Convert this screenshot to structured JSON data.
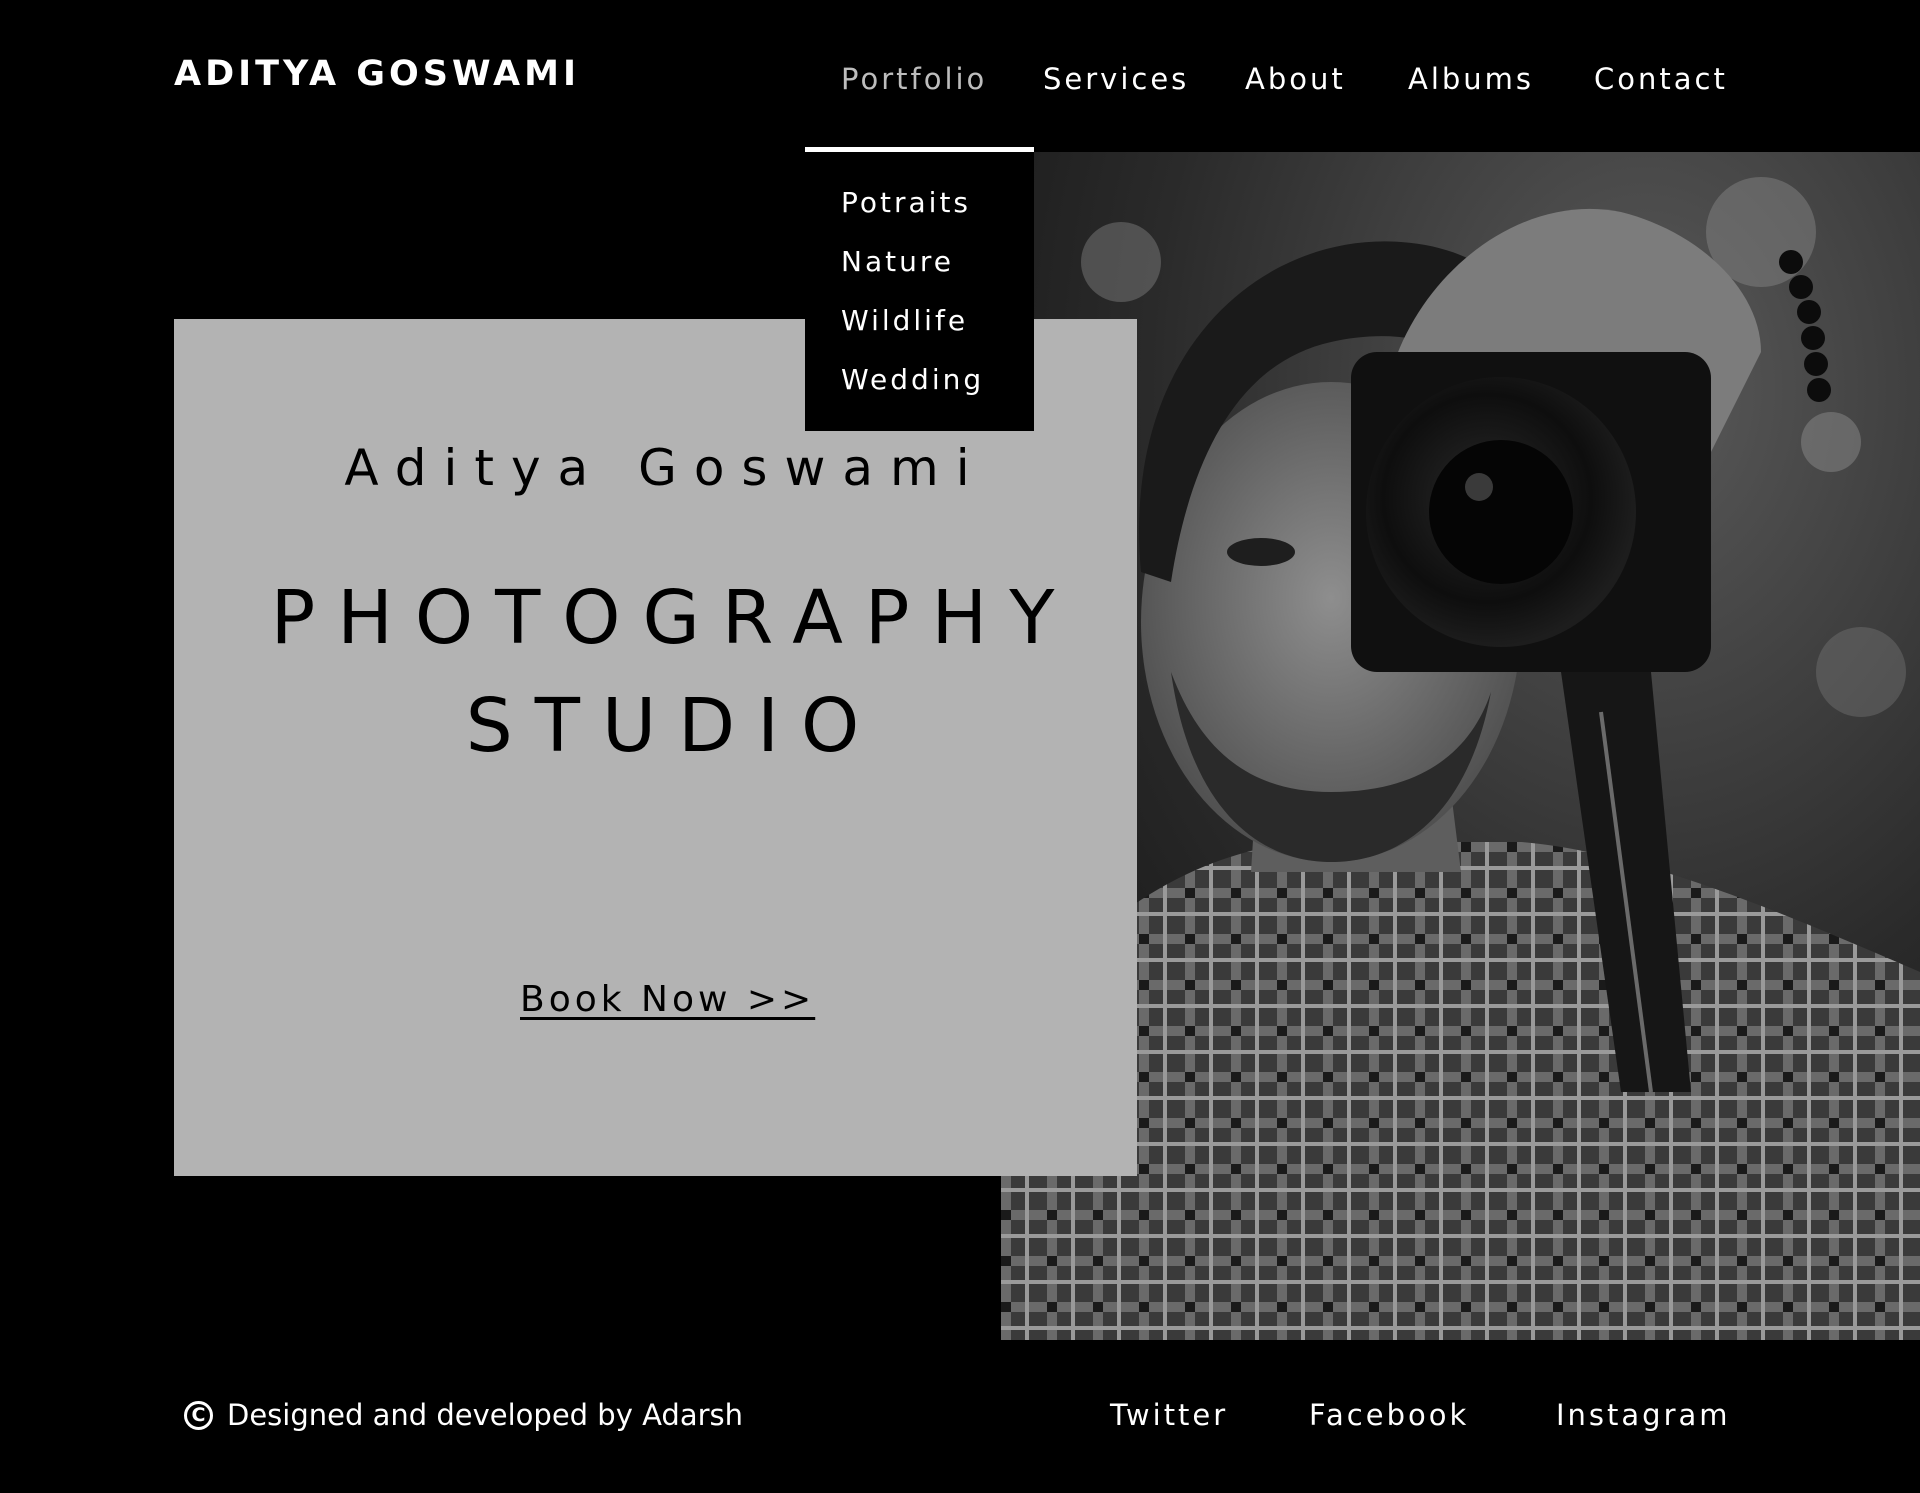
{
  "header": {
    "brand": "ADITYA GOSWAMI",
    "nav": [
      {
        "label": "Portfolio",
        "active": true
      },
      {
        "label": "Services"
      },
      {
        "label": "About"
      },
      {
        "label": "Albums"
      },
      {
        "label": "Contact"
      }
    ]
  },
  "dropdown": {
    "items": [
      "Potraits",
      "Nature",
      "Wildlife",
      "Wedding"
    ]
  },
  "hero": {
    "name": "Aditya Goswami",
    "title_line1": "PHOTOGRAPHY",
    "title_line2": "STUDIO",
    "cta": "Book Now >>",
    "photo_icon": "photographer-with-camera-image"
  },
  "footer": {
    "copyright_symbol": "C",
    "copyright_text": "Designed and developed by Adarsh",
    "social": [
      "Twitter",
      "Facebook",
      "Instagram"
    ]
  },
  "colors": {
    "background": "#000000",
    "card": "#b3b3b3",
    "text_light": "#ffffff",
    "text_dark": "#000000",
    "nav_active": "#bdbdbd"
  }
}
